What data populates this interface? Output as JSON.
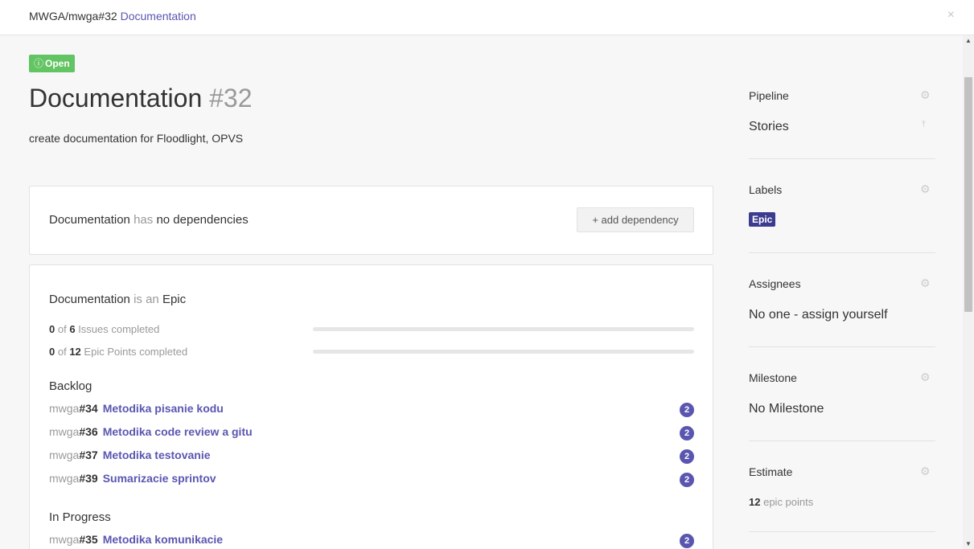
{
  "header": {
    "repo_ref": "MWGA/mwga#32",
    "title_link": "Documentation",
    "close_glyph": "×"
  },
  "issue": {
    "status": "Open",
    "status_icon": "ⓘ",
    "title": "Documentation",
    "number": "#32",
    "description": "create documentation for Floodlight, OPVS"
  },
  "dependencies": {
    "subject": "Documentation",
    "has": "has",
    "state": "no dependencies",
    "add_button": "+ add dependency"
  },
  "epic": {
    "subject": "Documentation",
    "is_an": "is an",
    "type": "Epic",
    "issues_progress": {
      "done": "0",
      "of": "of",
      "total": "6",
      "label": "Issues completed",
      "fraction": 0
    },
    "points_progress": {
      "done": "0",
      "of": "of",
      "total": "12",
      "label": "Epic Points completed",
      "fraction": 0
    },
    "groups": [
      {
        "title": "Backlog",
        "items": [
          {
            "repo": "mwga",
            "ref": "#34",
            "name": "Metodika pisanie kodu",
            "points": "2"
          },
          {
            "repo": "mwga",
            "ref": "#36",
            "name": "Metodika code review a gitu",
            "points": "2"
          },
          {
            "repo": "mwga",
            "ref": "#37",
            "name": "Metodika testovanie",
            "points": "2"
          },
          {
            "repo": "mwga",
            "ref": "#39",
            "name": "Sumarizacie sprintov",
            "points": "2"
          }
        ]
      },
      {
        "title": "In Progress",
        "items": [
          {
            "repo": "mwga",
            "ref": "#35",
            "name": "Metodika komunikacie",
            "points": "2"
          }
        ]
      }
    ]
  },
  "sidebar": {
    "pipeline": {
      "label": "Pipeline",
      "value": "Stories"
    },
    "labels": {
      "label": "Labels",
      "value": "Epic"
    },
    "assignees": {
      "label": "Assignees",
      "value": "No one - assign yourself"
    },
    "milestone": {
      "label": "Milestone",
      "value": "No Milestone"
    },
    "estimate": {
      "label": "Estimate",
      "amount": "12",
      "unit": "epic points"
    }
  },
  "icons": {
    "gear": "gear-icon",
    "close": "close-icon",
    "pin": "move-to-top-icon",
    "info": "info-circle-icon"
  },
  "colors": {
    "accent": "#5a56b0",
    "open_green": "#62c462",
    "label_epic": "#3b3b8f"
  }
}
